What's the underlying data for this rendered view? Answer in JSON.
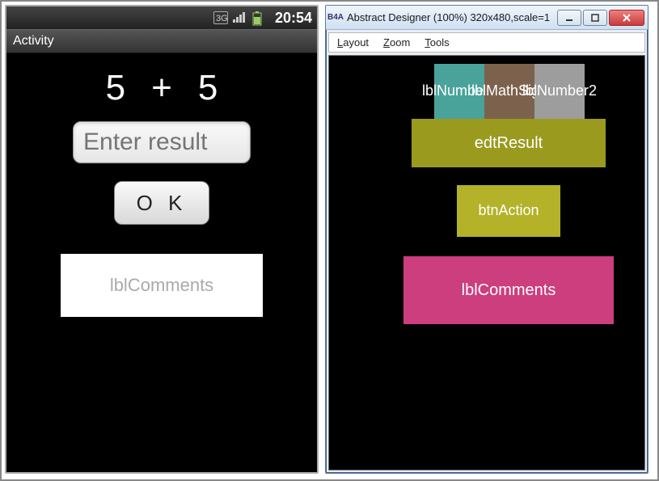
{
  "device": {
    "status": {
      "indicator_3g_top": "3G",
      "indicator_3g_bottom": "↕",
      "time": "20:54"
    },
    "title": "Activity",
    "math": {
      "number1": "5",
      "sign": "+",
      "number2": "5"
    },
    "result_placeholder": "Enter result",
    "ok_label": "O K",
    "comments_label": "lblComments"
  },
  "designer": {
    "window_title": "Abstract Designer (100%) 320x480,scale=1",
    "app_icon_text": "B4A",
    "menu": {
      "layout": "Layout",
      "zoom": "Zoom",
      "tools": "Tools"
    },
    "canvas": {
      "lblNumber1": "lblNumber1",
      "lblMathSign": "lblMathSign",
      "lblNumber2": "lblNumber2",
      "edtResult": "edtResult",
      "btnAction": "btnAction",
      "lblComments": "lblComments"
    }
  }
}
